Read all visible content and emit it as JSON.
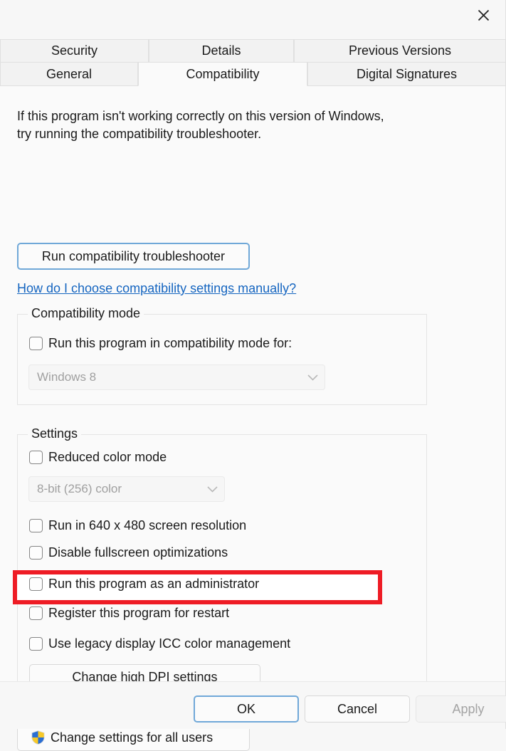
{
  "window": {
    "close_icon": "close-icon"
  },
  "tabs": {
    "row1": [
      {
        "label": "Security",
        "selected": false
      },
      {
        "label": "Details",
        "selected": false
      },
      {
        "label": "Previous Versions",
        "selected": false
      }
    ],
    "row2": [
      {
        "label": "General",
        "selected": false
      },
      {
        "label": "Compatibility",
        "selected": true
      },
      {
        "label": "Digital Signatures",
        "selected": false
      }
    ]
  },
  "main": {
    "intro_line1": "If this program isn't working correctly on this version of Windows,",
    "intro_line2": "try running the compatibility troubleshooter.",
    "run_troubleshooter_label": "Run compatibility troubleshooter",
    "help_link_label": "How do I choose compatibility settings manually?",
    "help_link_color": "#1565c0"
  },
  "compatibility_mode": {
    "group_label": "Compatibility mode",
    "checkbox_label": "Run this program in compatibility mode for:",
    "checkbox_checked": false,
    "os_value": "Windows 8",
    "os_disabled": true,
    "chevron_icon": "chevron-down-icon"
  },
  "settings": {
    "group_label": "Settings",
    "reduced_color_label": "Reduced color mode",
    "reduced_color_checked": false,
    "color_depth_value": "8-bit (256) color",
    "color_depth_disabled": true,
    "chevron_icon": "chevron-down-icon",
    "checkboxes": [
      {
        "label": "Run in 640 x 480 screen resolution",
        "checked": false,
        "highlighted": false
      },
      {
        "label": "Disable fullscreen optimizations",
        "checked": false,
        "highlighted": false
      },
      {
        "label": "Run this program as an administrator",
        "checked": false,
        "highlighted": true
      },
      {
        "label": "Register this program for restart",
        "checked": false,
        "highlighted": false
      },
      {
        "label": "Use legacy display ICC color management",
        "checked": false,
        "highlighted": false
      }
    ],
    "change_dpi_label": "Change high DPI settings",
    "highlight_color": "#ee1c25"
  },
  "all_users": {
    "label": "Change settings for all users",
    "shield_icon": "uac-shield-icon"
  },
  "footer": {
    "ok_label": "OK",
    "cancel_label": "Cancel",
    "apply_label": "Apply",
    "apply_disabled": true,
    "ok_focused": true
  }
}
